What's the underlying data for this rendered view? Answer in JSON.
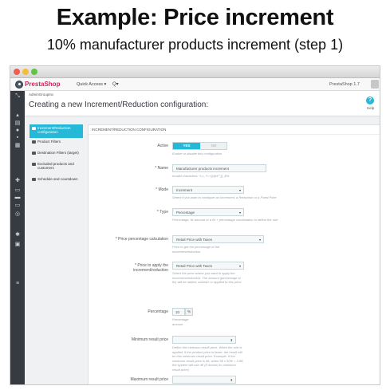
{
  "header": {
    "title": "Example: Price increment",
    "subtitle": "10% manufacturer products increment (step 1)"
  },
  "topbar": {
    "logo": "PrestaShop",
    "quick_access": "Quick Access ▾",
    "search": "Q▾",
    "version": "PrestaShop 1.7"
  },
  "page": {
    "breadcrumb": "AdminGroupInc",
    "title": "Creating a new Increment/Reduction configuration:",
    "help": "Help"
  },
  "nav": {
    "items": [
      "Increment/Reduction configuration",
      "Product Filters",
      "Destination Filters (target)",
      "Excluded products and customers",
      "Schedule and countdown"
    ]
  },
  "panel": {
    "heading": "INCREMENT/REDUCTION CONFIGURATION",
    "active": {
      "label": "Active",
      "yes": "YES",
      "no": "NO",
      "help": "Enable or disable this configuration"
    },
    "name": {
      "label": "* Name",
      "value": "Manufacturer products increment",
      "help": "Invalid characters: !<>,;?=+()@#\"°{}_$%:"
    },
    "mode": {
      "label": "* Mode",
      "value": "Increment",
      "help": "Select if you want to configure an Increment, a Reduction or a Fixed Price"
    },
    "type": {
      "label": "* Type",
      "value": "Percentage",
      "help": "Percentage, fix amount or a fix + percentage combination to define the rule"
    },
    "calc": {
      "label": "* Price percentage calculation",
      "value": "Retail Price with Taxes",
      "help": "Price to get the percentage of the increment/reduction"
    },
    "apply": {
      "label": "* Price to apply the increment/reduction",
      "value": "Retail Price with Taxes",
      "help": "Select the price where you want to apply the increment/reduction. The amount (percentage or fix) will be added, subtract or applied to this price."
    },
    "percentage": {
      "label": "Percentage",
      "value": "10",
      "addon": "%",
      "help": "Percentage amount"
    },
    "min": {
      "label": "Minimum result price",
      "value": "",
      "caret": "⬍",
      "help": "Define the minimum result price. When the rule is applied, if the product price is lower, the result will be this minimum result price. Example: If the minimum result price is 4€, when 5€ x 50% = 2.5€, the system will use 4€ (0 means no minimum result price)"
    },
    "max": {
      "label": "Maximum result price",
      "value": "",
      "caret": "⬍"
    }
  }
}
